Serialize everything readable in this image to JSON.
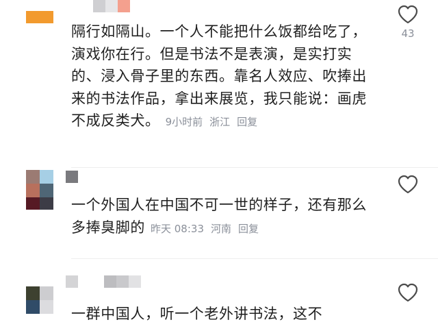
{
  "comments": [
    {
      "text": "隔行如隔山。一个人不能把什么饭都给吃了，演戏你在行。但是书法不是表演，是实打实的、浸入骨子里的东西。靠名人效应、吹捧出来的书法作品，拿出来展览，我只能说：画虎不成反类犬。",
      "time": "9小时前",
      "location": "浙江",
      "reply_label": "回复",
      "like_count": "43",
      "avatar_colors": [
        "#f0a030",
        "#f7c47a"
      ]
    },
    {
      "text": "一个外国人在中国不可一世的样子，还有那么多捧臭脚的",
      "time": "昨天 08:33",
      "location": "河南",
      "reply_label": "回复",
      "like_count": "",
      "avatar_colors": [
        "#8b6a63",
        "#9cc6df",
        "#b06b5a",
        "#4d6474",
        "#5a1a22",
        "#3a3a44"
      ]
    },
    {
      "text": "一群中国人，听一个老外讲书法，这不",
      "time": "",
      "location": "",
      "reply_label": "",
      "like_count": "",
      "avatar_colors": [
        "#3b3f2a",
        "#c9c9cc",
        "#2e4a66",
        "#d8d8db"
      ]
    }
  ],
  "icons": {
    "like": "heart-outline-icon"
  }
}
